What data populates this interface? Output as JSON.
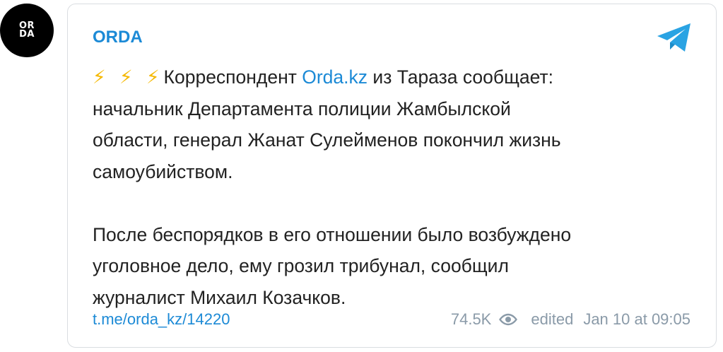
{
  "avatar": {
    "line1": "OR",
    "line2": "DA"
  },
  "channel": {
    "name": "ORDA"
  },
  "post": {
    "bolts": "⚡ ⚡ ⚡",
    "text_before_link": "Корреспондент ",
    "link_text": "Orda.kz",
    "line1_after": " из Тараза сообщает:",
    "line2": "начальник Департамента полиции Жамбылской",
    "line3": "области, генерал Жанат Сулейменов покончил жизнь",
    "line4": "самоубийством.",
    "para2_line1": "После беспорядков в его отношении было возбуждено",
    "para2_line2": "уголовное дело, ему грозил трибунал, сообщил",
    "para2_line3": "журналист Михаил Козачков."
  },
  "footer": {
    "link": "t.me/orda_kz/14220",
    "views": "74.5K",
    "edited": "edited",
    "date": "Jan 10 at 09:05"
  },
  "icons": {
    "telegram": "telegram-plane-icon",
    "views": "eye-icon"
  },
  "colors": {
    "accent": "#1c8ad6",
    "meta": "#8a9aa8",
    "bolt": "#f5b800"
  }
}
